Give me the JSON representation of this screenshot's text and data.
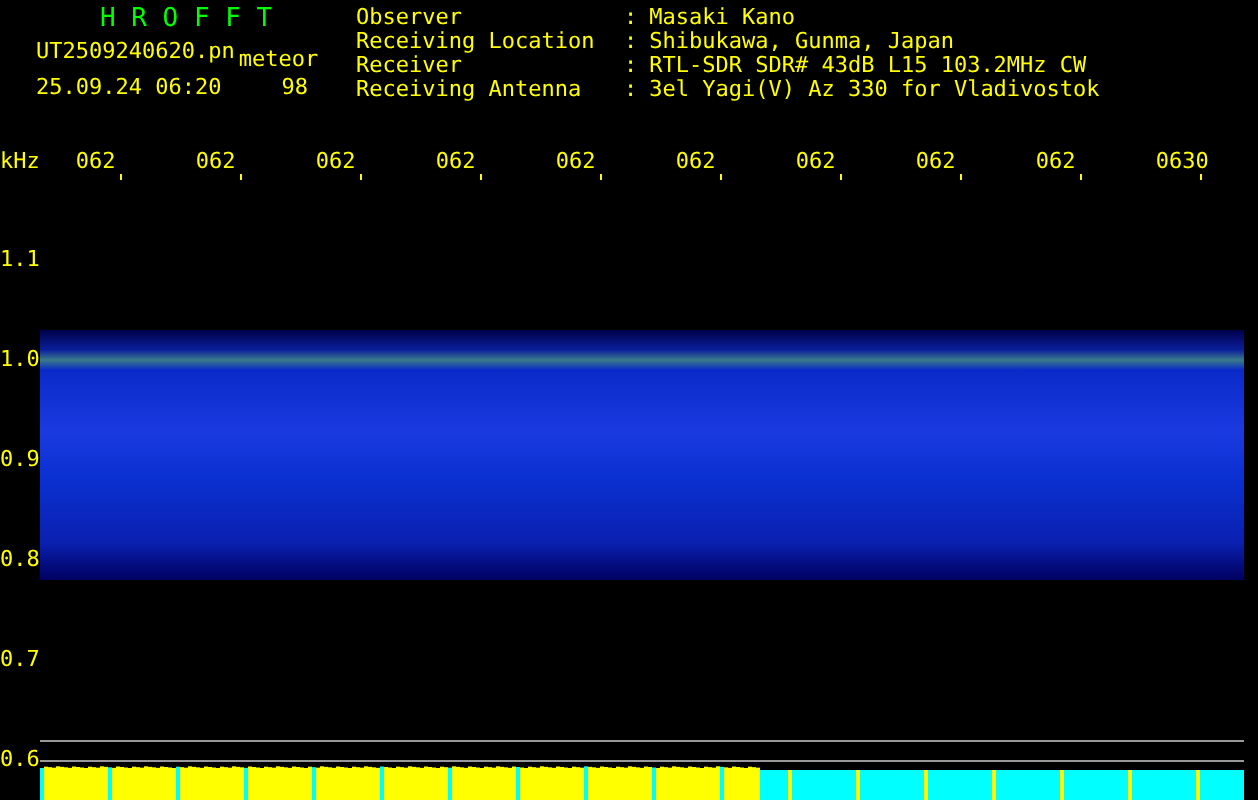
{
  "title": "H R O F F T",
  "file_name": "UT2509240620.pn",
  "mode": "meteor",
  "date_time": "25.09.24 06:20",
  "count": "98",
  "info": [
    {
      "label": "Observer",
      "separator": ":",
      "value": "Masaki Kano"
    },
    {
      "label": "Receiving Location",
      "separator": ":",
      "value": "Shibukawa, Gunma, Japan"
    },
    {
      "label": "Receiver",
      "separator": ":",
      "value": "RTL-SDR SDR# 43dB L15 103.2MHz CW"
    },
    {
      "label": "Receiving Antenna",
      "separator": ":",
      "value": "3el Yagi(V) Az 330 for Vladivostok"
    }
  ],
  "plot": {
    "unit": "kHz",
    "time_labels": [
      "062",
      "062",
      "062",
      "062",
      "062",
      "062",
      "062",
      "062",
      "062",
      "0630"
    ],
    "frequency_labels": [
      "1.1",
      "1.0",
      "0.9",
      "0.8",
      "0.7",
      "0.6"
    ]
  }
}
